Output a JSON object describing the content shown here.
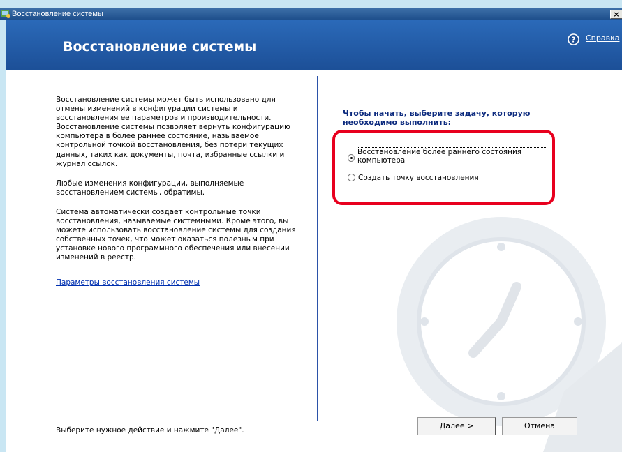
{
  "window": {
    "title": "Восстановление системы",
    "close_label": "×"
  },
  "header": {
    "title": "Восстановление системы",
    "help_label": "Справка"
  },
  "left": {
    "paragraphs": [
      "Восстановление системы может быть использовано для отмены изменений в конфигурации системы и восстановления ее параметров и производительности. Восстановление системы позволяет вернуть конфигурацию компьютера в более раннее состояние, называемое контрольной точкой восстановления, без потери текущих данных, таких как документы, почта, избранные ссылки и журнал ссылок.",
      "Любые изменения конфигурации, выполняемые восстановлением системы, обратимы.",
      "Система автоматически создает контрольные точки восстановления, называемые системными. Кроме этого, вы можете использовать восстановление системы для создания собственных точек, что может оказаться полезным при установке нового программного обеспечения или внесении изменений в реестр."
    ],
    "settings_link": "Параметры восстановления системы",
    "footer": "Выберите нужное действие и нажмите \"Далее\"."
  },
  "right": {
    "prompt": "Чтобы начать, выберите задачу, которую необходимо выполнить:",
    "options": [
      {
        "label": "Восстановление более раннего состояния компьютера",
        "checked": true
      },
      {
        "label": "Создать точку восстановления",
        "checked": false
      }
    ]
  },
  "buttons": {
    "next": "Далее >",
    "cancel": "Отмена"
  },
  "colors": {
    "header_bg": "#1c4f97",
    "highlight": "#e8001e",
    "prompt_text": "#0c2a7e",
    "link": "#0030b0"
  }
}
